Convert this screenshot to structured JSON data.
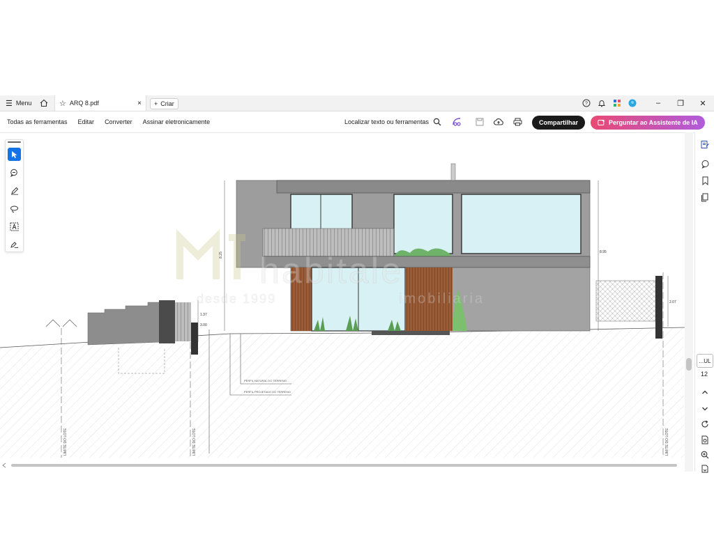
{
  "titlebar": {
    "menu_label": "Menu",
    "tab_title": "ARQ 8.pdf",
    "tab_close": "×",
    "new_tab_label": "Criar",
    "icons": [
      "help-icon",
      "bell-icon",
      "apps-icon",
      "account-icon"
    ],
    "window_controls": [
      "–",
      "❐",
      "✕"
    ]
  },
  "toolbar": {
    "nav": [
      "Todas as ferramentas",
      "Editar",
      "Converter",
      "Assinar eletronicamente"
    ],
    "search_label": "Localizar texto ou ferramentas",
    "share_label": "Compartilhar",
    "ai_label": "Perguntar ao Assistente de IA"
  },
  "palette": {
    "tools": [
      "select-tool",
      "comment-tool",
      "draw-tool",
      "lasso-tool",
      "text-select-tool",
      "sign-tool"
    ]
  },
  "right_panel": {
    "page_box": "...UL",
    "page_number": "12"
  },
  "drawing": {
    "watermark_main": "habitale",
    "watermark_sub": "imobiliaria",
    "watermark_since": "desde 1999",
    "notes": [
      "PERFIL NATURAL DO TERRENO",
      "PERFIL PROJETADO DO TERRENO"
    ],
    "limits": [
      "LIMITE DO LOTE",
      "LIMITE DO LOTE",
      "LIMITE DO LOTE"
    ],
    "dims": [
      "8.25",
      "8.95",
      "2.07",
      "1.37",
      "3.00"
    ]
  },
  "colors": {
    "accent": "#1473e6",
    "share_bg": "#1a1a1a",
    "ai_from": "#e84a74",
    "ai_to": "#b05cdc",
    "facade": "#9a9a9a",
    "glass": "#d8f1f4",
    "wood": "#9a5b37"
  }
}
